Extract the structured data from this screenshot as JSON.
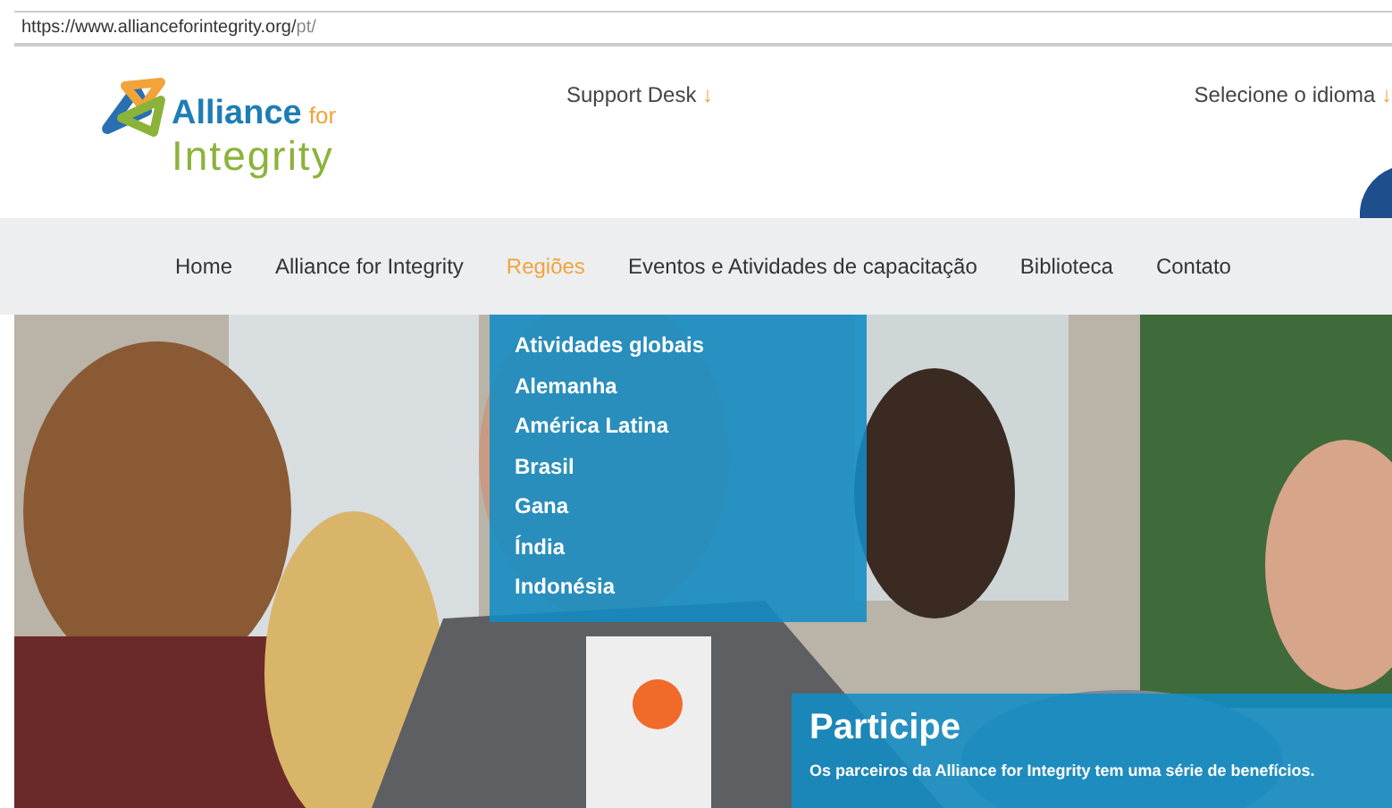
{
  "address_bar": {
    "url": "https://www.allianceforintegrity.org/",
    "path": "pt/"
  },
  "logo": {
    "word_1": "Alliance",
    "word_2": "for",
    "word_3": "Integrity"
  },
  "header_links": [
    {
      "label": "Support Desk",
      "arrow": "↓"
    },
    {
      "label": "Selecione o idioma",
      "arrow": "↓"
    }
  ],
  "nav": {
    "items": [
      {
        "label": "Home",
        "selected": false
      },
      {
        "label": "Alliance for Integrity",
        "selected": false
      },
      {
        "label": "Regiões",
        "selected": true,
        "expanded": true,
        "children": [
          {
            "label": "Atividades globais"
          },
          {
            "label": "Alemanha"
          },
          {
            "label": "América Latina"
          },
          {
            "label": "Brasil"
          },
          {
            "label": "Gana"
          },
          {
            "label": "Índia"
          },
          {
            "label": "Indonésia"
          }
        ]
      },
      {
        "label": "Eventos e Atividades de capacitação",
        "selected": false
      },
      {
        "label": "Biblioteca",
        "selected": false
      },
      {
        "label": "Contato",
        "selected": false
      }
    ]
  },
  "hero": {
    "kind": "picture",
    "panel": {
      "title": "Participe",
      "text": "Os parceiros da Alliance for Integrity tem uma série de benefícios."
    }
  }
}
